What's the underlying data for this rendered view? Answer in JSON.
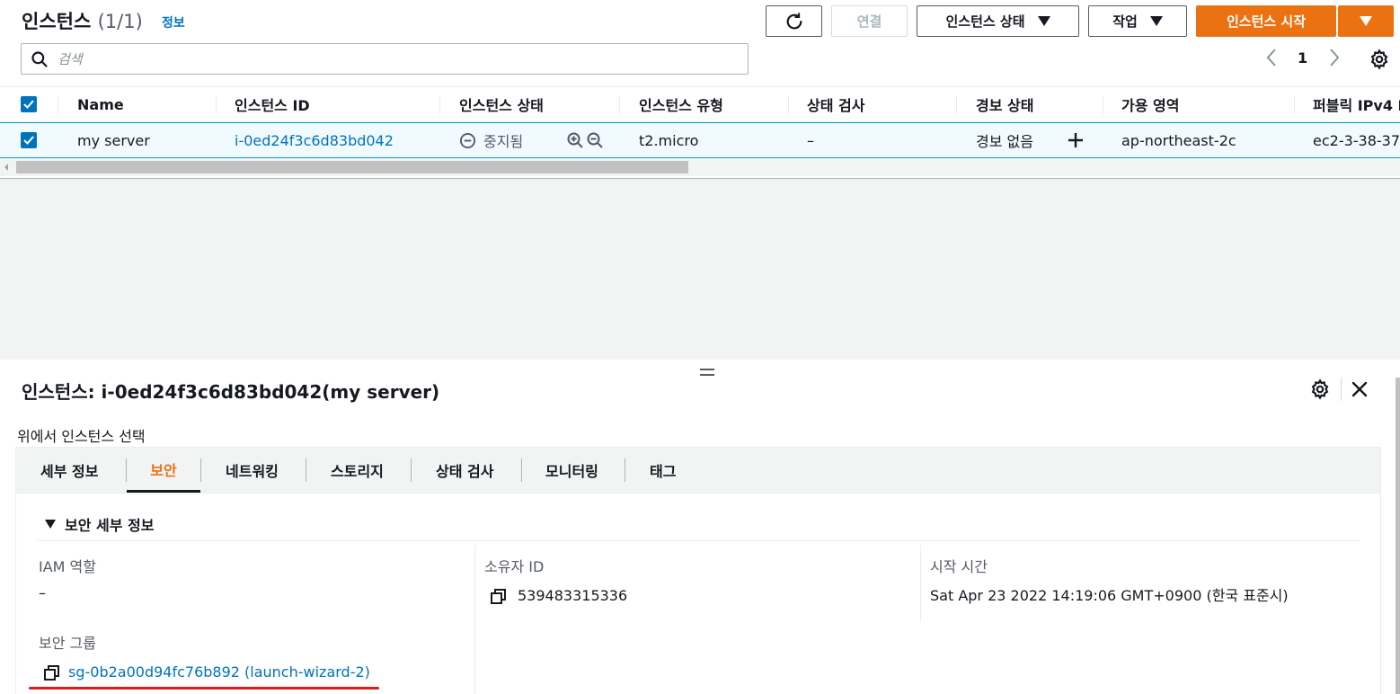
{
  "header": {
    "title": "인스턴스",
    "count": "(1/1)",
    "info_link": "정보",
    "buttons": {
      "connect": "연결",
      "instance_state": "인스턴스 상태",
      "actions": "작업",
      "launch": "인스턴스 시작"
    }
  },
  "search": {
    "placeholder": "검색"
  },
  "pagination": {
    "page": "1"
  },
  "table": {
    "columns": [
      "Name",
      "인스턴스 ID",
      "인스턴스 상태",
      "인스턴스 유형",
      "상태 검사",
      "경보 상태",
      "가용 영역",
      "퍼블릭 IPv4 I"
    ],
    "rows": [
      {
        "name": "my server",
        "instance_id": "i-0ed24f3c6d83bd042",
        "state": "중지됨",
        "type": "t2.micro",
        "status_check": "–",
        "alarm": "경보 없음",
        "az": "ap-northeast-2c",
        "public_ip": "ec2-3-38-37"
      }
    ]
  },
  "detail": {
    "title": "인스턴스: i-0ed24f3c6d83bd042(my server)",
    "subtitle": "위에서 인스턴스 선택",
    "tabs": [
      "세부 정보",
      "보안",
      "네트워킹",
      "스토리지",
      "상태 검사",
      "모니터링",
      "태그"
    ],
    "active_tab": "보안",
    "section_title": "보안 세부 정보",
    "fields": {
      "iam_role_label": "IAM 역할",
      "iam_role_value": "–",
      "owner_id_label": "소유자 ID",
      "owner_id_value": "539483315336",
      "launch_time_label": "시작 시간",
      "launch_time_value": "Sat Apr 23 2022 14:19:06 GMT+0900 (한국 표준시)",
      "security_group_label": "보안 그룹",
      "security_group_value": "sg-0b2a00d94fc76b892 (launch-wizard-2)"
    }
  },
  "colors": {
    "accent_orange": "#ec7211",
    "link_blue": "#0073bb",
    "annotation_red": "#e01a1a"
  },
  "icons": [
    "refresh-icon",
    "search-icon",
    "settings-icon",
    "close-icon",
    "copy-icon",
    "stopped-icon",
    "zoom-in-icon",
    "zoom-out-icon",
    "plus-icon"
  ]
}
